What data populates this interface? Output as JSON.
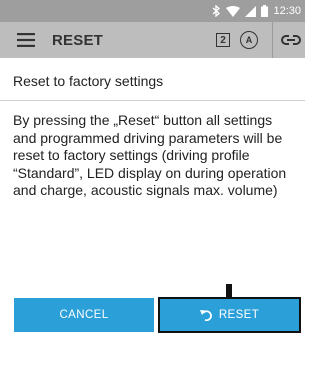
{
  "status_bar": {
    "time": "12:30",
    "icons": [
      "bluetooth-icon",
      "wifi-icon",
      "signal-icon",
      "battery-icon"
    ]
  },
  "app_bar": {
    "title": "RESET",
    "profile_number": "2",
    "assist_label": "A",
    "icons": [
      "menu-icon",
      "profile-icon",
      "assist-icon",
      "link-icon"
    ]
  },
  "content": {
    "heading": "Reset to factory settings",
    "description": "By pressing the „Reset“ button all settings and programmed driving parameters will be reset to factory settings (driving profile “Standard”, LED display on during operation and charge, acoustic signals max. volume)"
  },
  "buttons": {
    "cancel_label": "CANCEL",
    "reset_label": "RESET"
  },
  "colors": {
    "status_bar": "#9e9e9e",
    "app_bar": "#bdbdbd",
    "button": "#2a9fd8",
    "highlight_outline": "#111111"
  }
}
